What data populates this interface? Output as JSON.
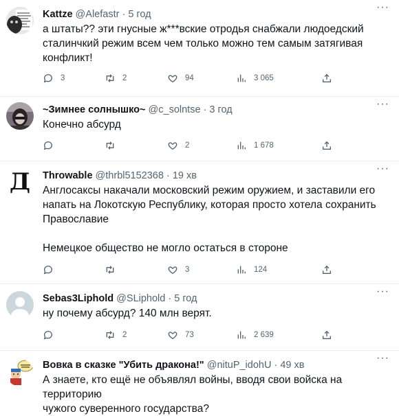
{
  "tweets": [
    {
      "name": "Kattze",
      "handle": "@Alefastr",
      "dot": "·",
      "time": "5 год",
      "lines": [
        "а штаты?? эти гнусные ж***вские отродья снабжали людоедский",
        "сталинчкий режим всем чем только можно тем самым затягивая",
        "конфликт!"
      ],
      "replies": "3",
      "retweets": "2",
      "likes": "94",
      "views": "3 065"
    },
    {
      "name": "~Зимнее солнышко~",
      "handle": "@c_solntse",
      "dot": "·",
      "time": "3 год",
      "lines": [
        "Конечно абсурд"
      ],
      "replies": "",
      "retweets": "",
      "likes": "2",
      "views": "1 678"
    },
    {
      "name": "Throwable",
      "handle": "@thrbl5152368",
      "dot": "·",
      "time": "19 хв",
      "avatar_letter": "Д",
      "lines": [
        "Англосаксы накачали московский режим оружием, и заставили его",
        "напать на Локотскую Республику, которая просто хотела сохранить",
        "Православие",
        "",
        "Немецкое общество не могло остаться в стороне"
      ],
      "replies": "",
      "retweets": "",
      "likes": "3",
      "views": "124"
    },
    {
      "name": "Sebas3Liphold",
      "handle": "@SLiphold",
      "dot": "·",
      "time": "5 год",
      "lines": [
        "ну почему абсурд? 140 млн верят."
      ],
      "replies": "",
      "retweets": "2",
      "likes": "73",
      "views": "2 639"
    },
    {
      "name": "Вовка в сказке \"Убить дракона!\"",
      "handle": "@nituP_idohU",
      "dot": "·",
      "time": "49 хв",
      "lines": [
        "А знаете, кто ещё не объявлял войны, вводя свои войска на территорию",
        "чужого суверенного государства?"
      ]
    }
  ],
  "icons": {
    "reply": "reply-icon",
    "retweet": "retweet-icon",
    "like": "like-icon",
    "views": "views-icon",
    "share": "share-icon",
    "more": "more-icon"
  },
  "colors": {
    "text": "#0f1419",
    "secondary": "#536471",
    "divider": "#e6ecf0"
  },
  "more_glyph": "···"
}
